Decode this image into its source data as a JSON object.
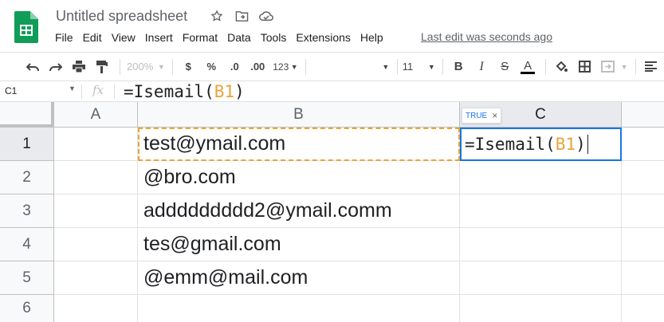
{
  "app": {
    "title": "Untitled spreadsheet",
    "brand_color": "#0f9d58",
    "icons": [
      "star-icon",
      "move-to-folder-icon",
      "cloud-status-icon"
    ]
  },
  "menu": {
    "items": [
      "File",
      "Edit",
      "View",
      "Insert",
      "Format",
      "Data",
      "Tools",
      "Extensions",
      "Help"
    ],
    "last_edit": "Last edit was seconds ago"
  },
  "toolbar": {
    "zoom": "200%",
    "currency": "$",
    "percent": "%",
    "decrease_decimal": ".0",
    "increase_decimal": ".00",
    "more_formats": "123",
    "font": "",
    "font_size": "11",
    "bold": "B",
    "italic": "I",
    "strikethrough": "S",
    "text_color": "A"
  },
  "formula_bar": {
    "name_box": "C1",
    "fx_label": "fx",
    "formula_prefix": "=Isemail(",
    "formula_ref": "B1",
    "formula_suffix": ")"
  },
  "grid": {
    "columns": [
      "A",
      "B",
      "C"
    ],
    "rows": [
      "1",
      "2",
      "3",
      "4",
      "5",
      "6"
    ],
    "column_b_values": [
      "test@ymail.com",
      "@bro.com",
      "addddddddd2@ymail.comm",
      "tes@gmail.com",
      "@emm@mail.com",
      ""
    ],
    "selected_cell": "C1",
    "referenced_cell": "B1",
    "ref_color": "#e8a43a",
    "selection_color": "#1a73e8"
  },
  "preview_chip": {
    "label": "TRUE",
    "close": "×"
  }
}
